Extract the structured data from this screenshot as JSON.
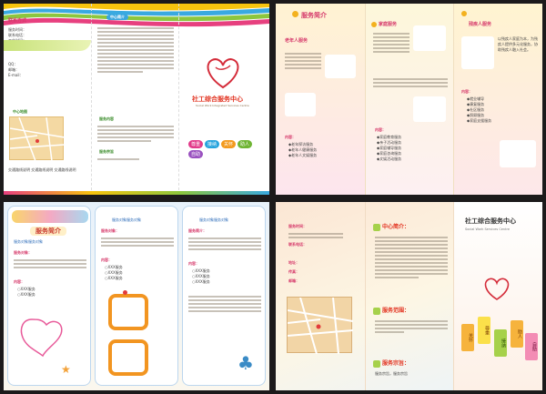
{
  "q1": {
    "contact_title": "联系方式",
    "contact_lines": [
      "服务时间：",
      "联系电话：",
      "工作时间：",
      "QQ：",
      "邮箱：",
      "E-mail："
    ],
    "map_title": "中心地图",
    "intro_title": "中心简介",
    "service_title": "服务内容",
    "purpose_title": "服务宗旨",
    "address_line": "交通路线说明 交通路线说明 交通路线说明",
    "center_name": "社工综合服务中心",
    "center_name_en": "Social Work Integrated Services Centre",
    "slogans": [
      "尊重",
      "接纳",
      "关怀",
      "助人",
      "自助"
    ]
  },
  "q2": {
    "intro_title": "服务简介",
    "elder_title": "老年人服务",
    "family_title": "家庭服务",
    "youth_title": "残疾人服务",
    "content_label": "内容：",
    "elder_items": [
      "◆老年探访服务",
      "◆老年人健康服务",
      "◆老年人文娱服务"
    ],
    "family_items": [
      "◆家庭教育服务",
      "◆亲子活动服务",
      "◆家庭辅导服务",
      "◆家庭咨询服务",
      "◆文娱活动服务"
    ],
    "youth_items": [
      "◆就业辅导",
      "◆康复服务",
      "◆社区服务",
      "◆照顾服务",
      "◆家庭支援服务"
    ],
    "youth_text": "以残疾人家庭为本，为残疾人提供多元化服务，协助残疾人融入社会。"
  },
  "q3": {
    "header": "服务简介",
    "card1_title": "服务对象服务对象",
    "card2_title": "服务对象服务对象",
    "card3_title": "服务对象服务对象",
    "obj_label": "服务对象：",
    "content_label": "内容：",
    "intro_label": "服务简介：",
    "item_lines": [
      "○XXX服务",
      "○XXX服务",
      "○XXX服务"
    ],
    "card3_items": [
      "○XXX服务",
      "○XXX服务",
      "○XXX服务"
    ]
  },
  "q4": {
    "time_label": "服务时间：",
    "phone_label": "联系电话：",
    "addr_label": "地址：",
    "fax_label": "传真：",
    "email_label": "邮箱：",
    "intro_title": "中心简介：",
    "scope_title": "服务范围：",
    "purpose_title": "服务宗旨：",
    "purpose_text": "服务宗旨，服务宗旨",
    "center_name": "社工综合服务中心",
    "center_name_en": "Social Work Services Centre",
    "tags": [
      "关怀",
      "尊重",
      "接纳",
      "助人",
      "自助"
    ]
  }
}
